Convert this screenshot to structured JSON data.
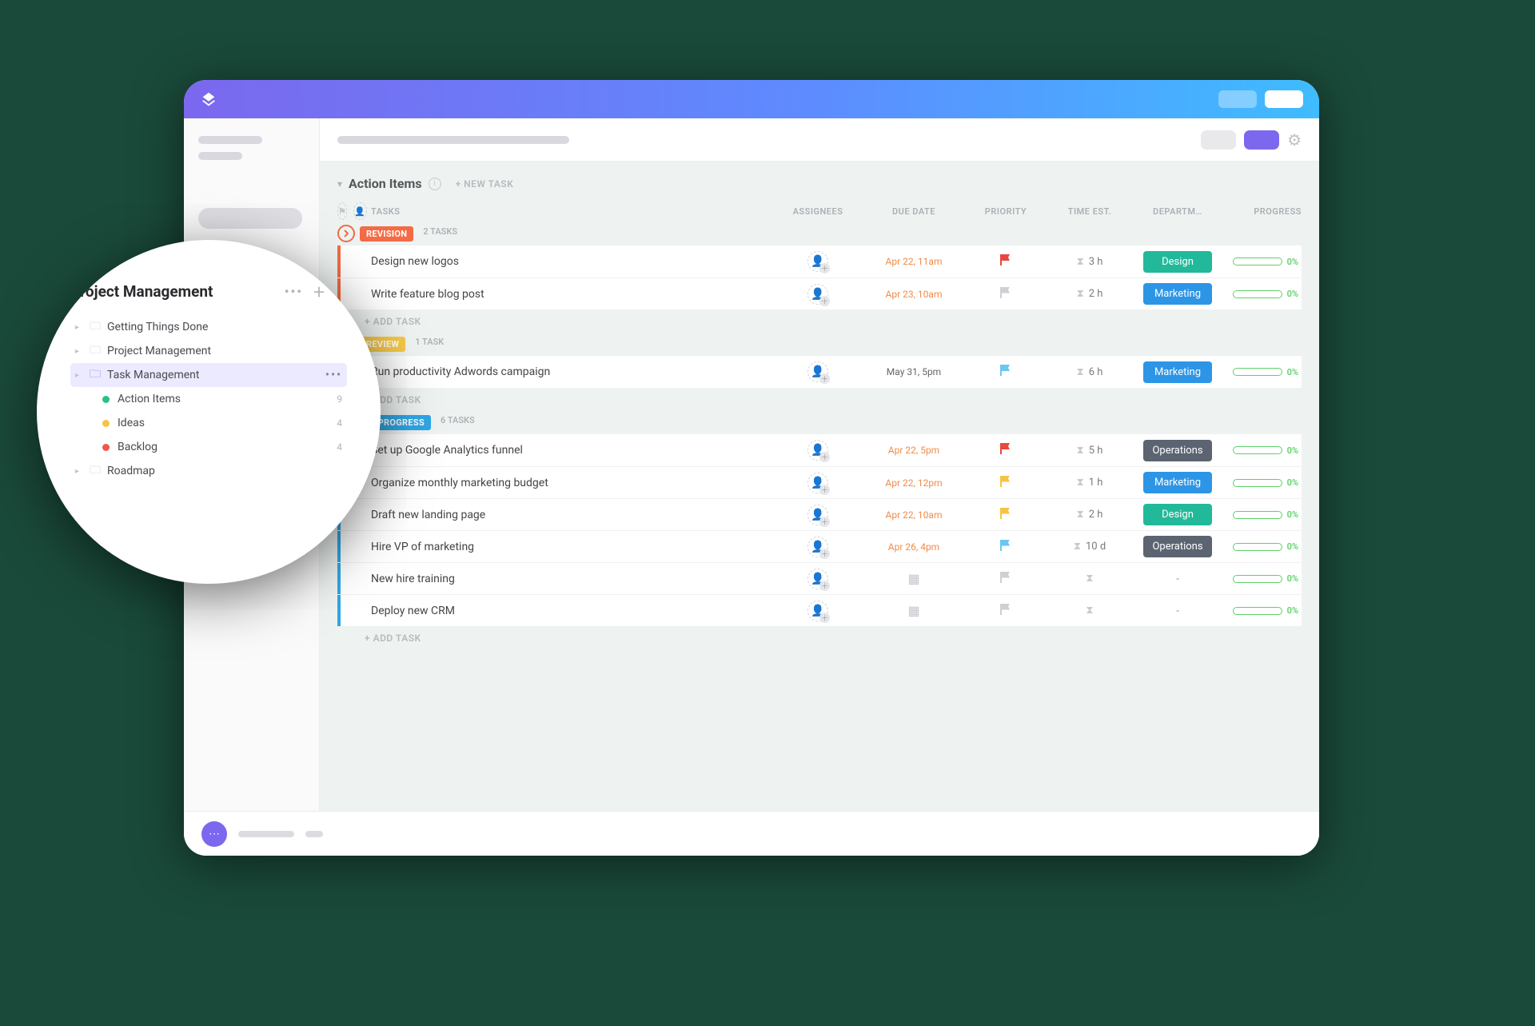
{
  "list": {
    "title": "Action Items",
    "new_task": "+ NEW TASK"
  },
  "columns": {
    "tasks": "TASKS",
    "assignees": "ASSIGNEES",
    "due": "DUE DATE",
    "priority": "PRIORITY",
    "time": "TIME EST.",
    "dept": "DEPARTM…",
    "progress": "PROGRESS"
  },
  "add_task": "+ ADD TASK",
  "groups": [
    {
      "status": "REVISION",
      "count": "2 TASKS",
      "style": "revision",
      "tasks": [
        {
          "name": "Design new logos",
          "due": "Apr 22, 11am",
          "due_style": "orange",
          "flag": "red",
          "time": "3 h",
          "dept": "Design",
          "dept_style": "design",
          "pct": "0%"
        },
        {
          "name": "Write feature blog post",
          "due": "Apr 23, 10am",
          "due_style": "orange",
          "flag": "gray",
          "time": "2 h",
          "dept": "Marketing",
          "dept_style": "marketing",
          "pct": "0%"
        }
      ]
    },
    {
      "status": "REVIEW",
      "count": "1 TASK",
      "style": "review",
      "tasks": [
        {
          "name": "Run productivity Adwords campaign",
          "due": "May 31, 5pm",
          "due_style": "gray",
          "flag": "blue",
          "time": "6 h",
          "dept": "Marketing",
          "dept_style": "marketing",
          "pct": "0%"
        }
      ]
    },
    {
      "status": "IN PROGRESS",
      "count": "6 TASKS",
      "style": "inprog",
      "tasks": [
        {
          "name": "Set up Google Analytics funnel",
          "due": "Apr 22, 5pm",
          "due_style": "orange",
          "flag": "red",
          "time": "5 h",
          "dept": "Operations",
          "dept_style": "operations",
          "pct": "0%"
        },
        {
          "name": "Organize monthly marketing budget",
          "due": "Apr 22, 12pm",
          "due_style": "orange",
          "flag": "yellow",
          "time": "1 h",
          "dept": "Marketing",
          "dept_style": "marketing",
          "pct": "0%"
        },
        {
          "name": "Draft new landing page",
          "due": "Apr 22, 10am",
          "due_style": "orange",
          "flag": "yellow",
          "time": "2 h",
          "dept": "Design",
          "dept_style": "design",
          "pct": "0%"
        },
        {
          "name": "Hire VP of marketing",
          "due": "Apr 26, 4pm",
          "due_style": "orange",
          "flag": "blue",
          "time": "10 d",
          "dept": "Operations",
          "dept_style": "operations",
          "pct": "0%"
        },
        {
          "name": "New hire training",
          "due": "",
          "due_style": "cal",
          "flag": "gray",
          "time": "",
          "dept": "-",
          "dept_style": "none",
          "pct": "0%"
        },
        {
          "name": "Deploy new CRM",
          "due": "",
          "due_style": "cal",
          "flag": "gray",
          "time": "",
          "dept": "-",
          "dept_style": "none",
          "pct": "0%"
        }
      ]
    }
  ],
  "sidebar": {
    "title": "Project Management",
    "folders": [
      {
        "label": "Getting Things Done"
      },
      {
        "label": "Project Management"
      },
      {
        "label": "Task Management",
        "selected": true
      },
      {
        "label": "Roadmap"
      }
    ],
    "lists": [
      {
        "label": "Action Items",
        "dot": "green",
        "count": "9"
      },
      {
        "label": "Ideas",
        "dot": "yellow",
        "count": "4"
      },
      {
        "label": "Backlog",
        "dot": "red",
        "count": "4"
      }
    ]
  }
}
